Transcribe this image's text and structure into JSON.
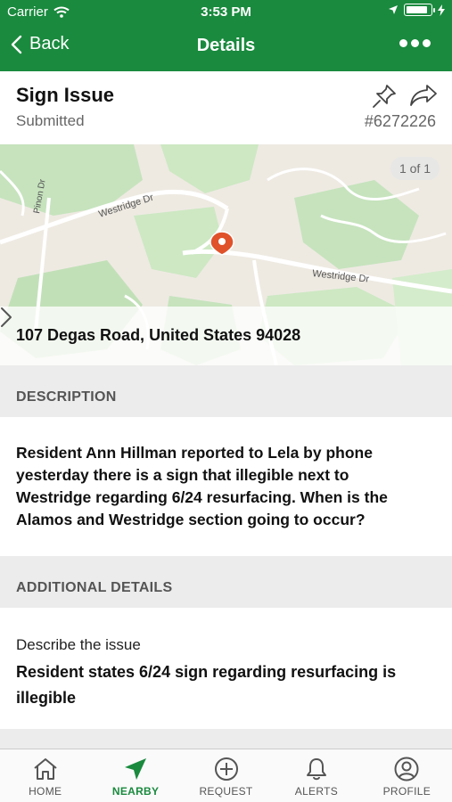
{
  "status_bar": {
    "carrier": "Carrier",
    "time": "3:53 PM",
    "battery_level": 0.9
  },
  "nav": {
    "back_label": "Back",
    "title": "Details"
  },
  "issue": {
    "title": "Sign Issue",
    "status": "Submitted",
    "id": "#6272226"
  },
  "map": {
    "counter": "1 of 1",
    "street_labels": [
      "Westridge Dr",
      "Westridge Dr",
      "Pinon Dr"
    ],
    "address": "107   Degas Road, United States  94028"
  },
  "description": {
    "header": "DESCRIPTION",
    "text": "Resident Ann Hillman reported to Lela by phone yesterday there is a sign that illegible next to Westridge regarding 6/24 resurfacing. When is the Alamos and Westridge section going to occur?"
  },
  "additional": {
    "header": "ADDITIONAL DETAILS",
    "field_label": "Describe the issue",
    "field_value": "Resident states 6/24 sign regarding resurfacing is illegible"
  },
  "tabs": [
    {
      "label": "HOME",
      "icon": "home-icon"
    },
    {
      "label": "NEARBY",
      "icon": "location-arrow-icon"
    },
    {
      "label": "REQUEST",
      "icon": "plus-circle-icon"
    },
    {
      "label": "ALERTS",
      "icon": "bell-icon"
    },
    {
      "label": "PROFILE",
      "icon": "person-icon"
    }
  ],
  "colors": {
    "brand": "#1a8a3e",
    "marker": "#e0522a",
    "map_green": "#c6e3bd"
  }
}
